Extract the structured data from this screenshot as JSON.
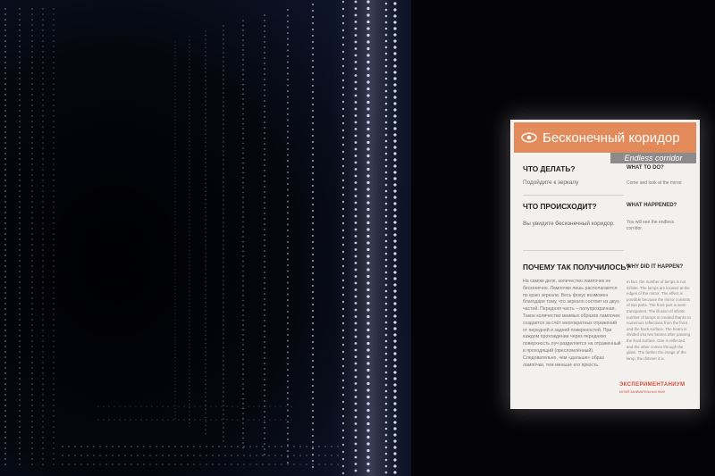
{
  "scene": {
    "description_name": "infinity-mirror-exhibit",
    "colors": {
      "background": "#050508",
      "led": "#dfe6ff",
      "accent": "#e38a5a"
    }
  },
  "placard": {
    "icon": "eye-icon",
    "title_ru": "Бесконечный коридор",
    "title_en": "Endless corridor",
    "q1_ru": "ЧТО ДЕЛАТЬ?",
    "q1_en": "WHAT TO DO?",
    "a1_ru": "Подойдите к зеркалу",
    "a1_en": "Come and look at the mirror",
    "q2_ru": "ЧТО ПРОИСХОДИТ?",
    "q2_en": "WHAT HAPPENED?",
    "a2_ru": "Вы увидите бесконечный коридор.",
    "a2_en": "You will see the endless corridor.",
    "q3_ru": "ПОЧЕМУ ТАК ПОЛУЧИЛОСЬ?",
    "q3_en": "WHY DID IT HAPPEN?",
    "body_ru": "На самом деле, количество лампочек не бесконечно. Лампочки лишь располагаются по краю зеркала. Весь фокус возможен благодаря тому, что зеркало состоит из двух частей. Передняя часть – полупрозрачная. Такое количество мнимых образов лампочек создается за счёт многократных отражений от передней и задней поверхностей. При каждом прохождении через переднюю поверхность луч разделяется на отраженный и проходящий (пресломлённый). Следовательно, чем «дальше» образ лампочки, тем меньше его яркость.",
    "body_en": "In fact, the number of lamps is not infinite. The lamps are located at the edges of the mirror. The effect is possible because the mirror consists of two parts. The front part is semi-transparent. The illusion of infinite number of lamps is created thanks to numerous reflections from the front and the back surface. The beam is divided into two beams after passing the front surface. One is reflected and the other comes through the glass. The farther the image of the lamp, the dimmer it is.",
    "logo": "ЭКСПЕРИМЕНТАНИУМ",
    "logo_sub": "МУЗЕЙ ЗАНИМАТЕЛЬНЫХ НАУК"
  }
}
